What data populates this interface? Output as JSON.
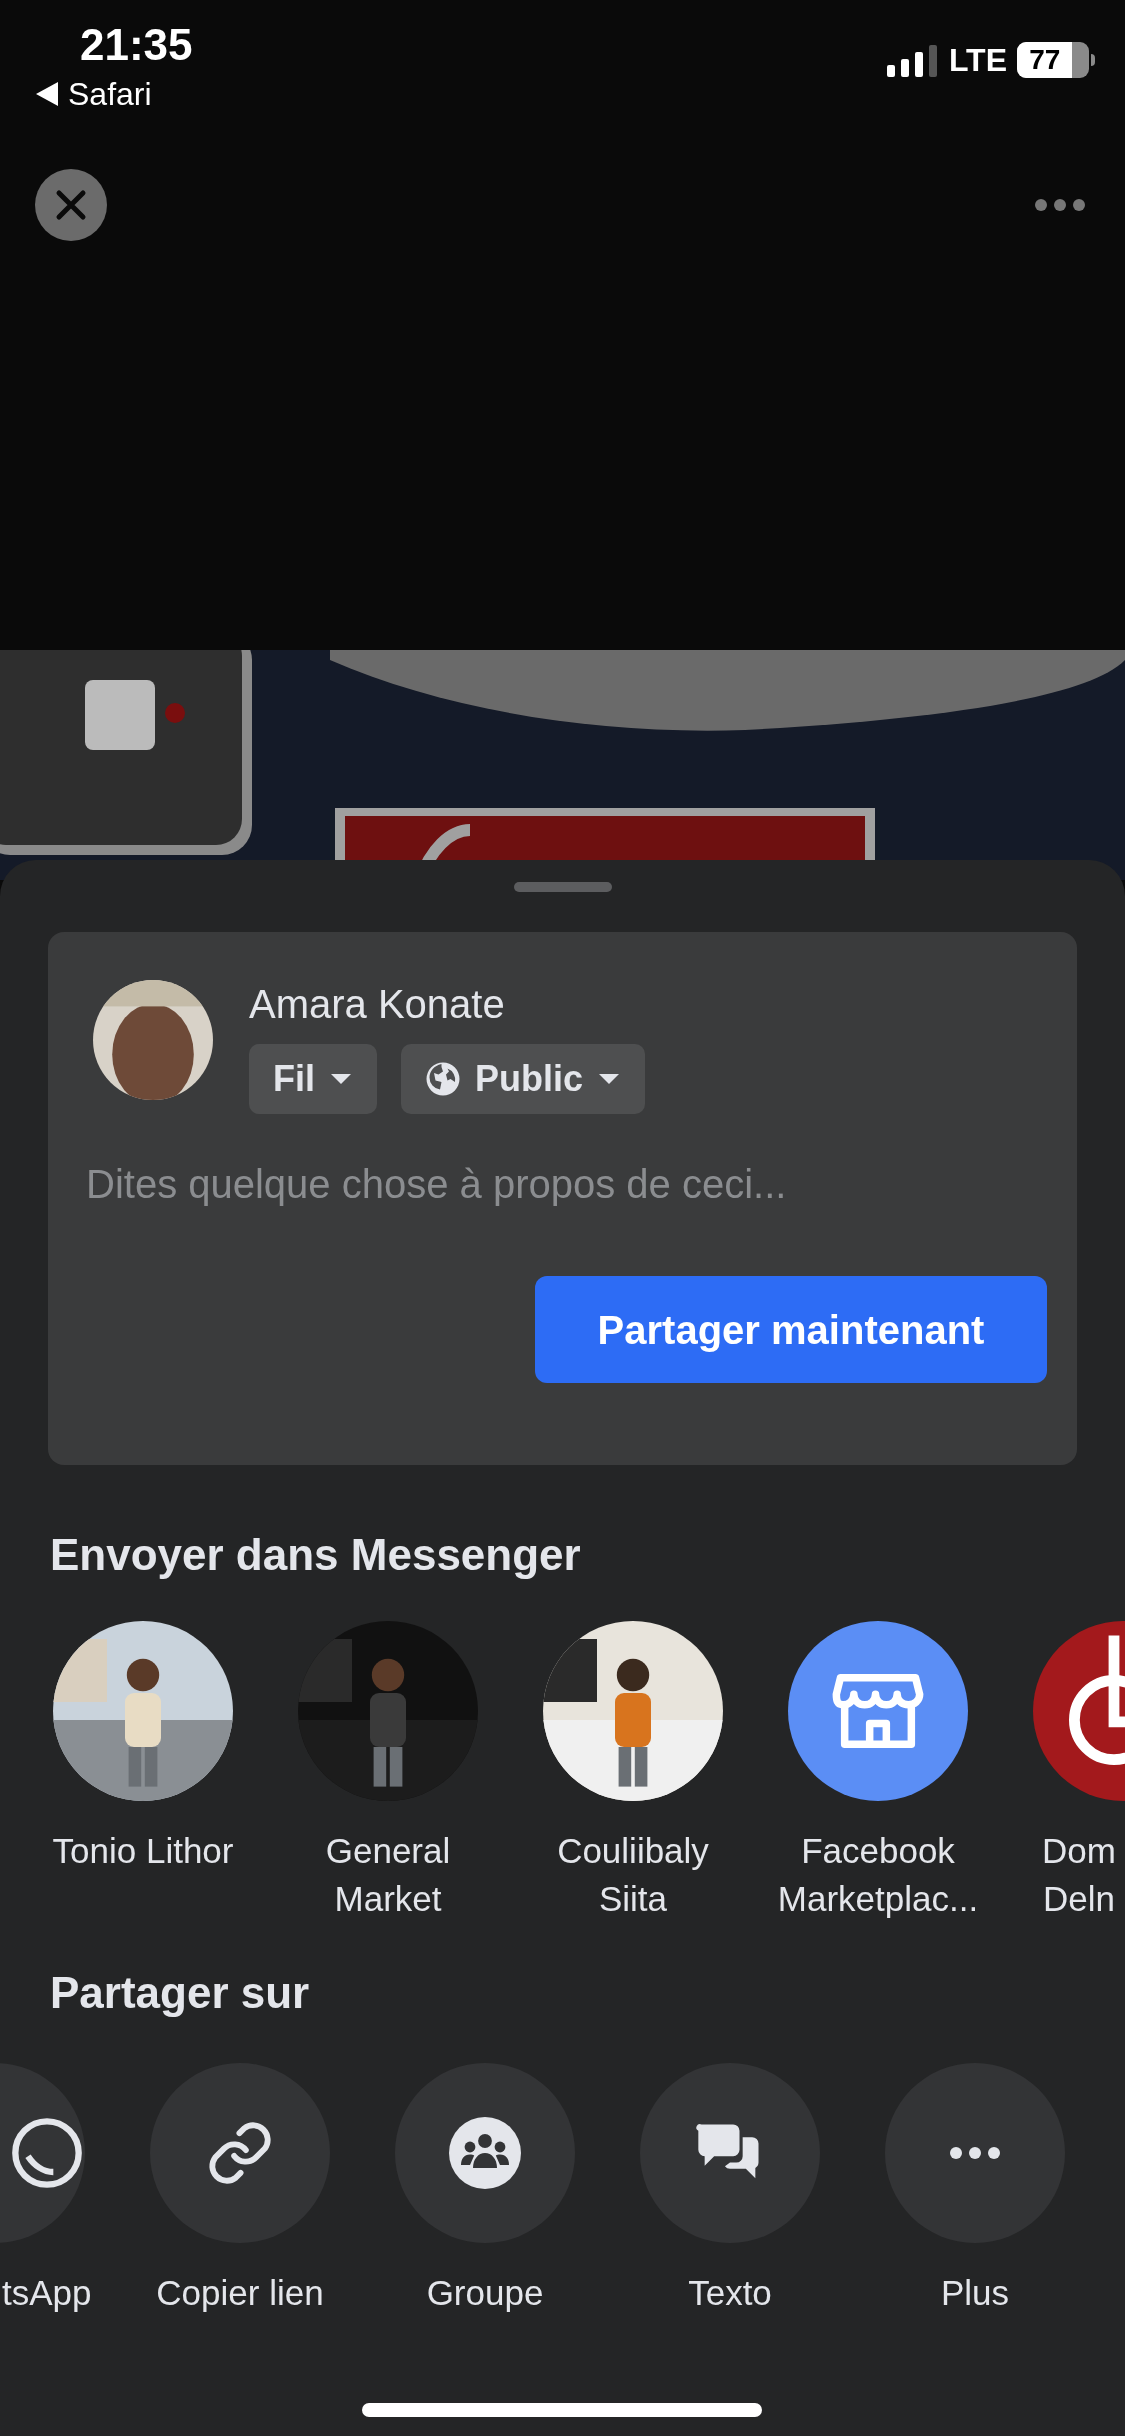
{
  "status_bar": {
    "time": "21:35",
    "back_app": "Safari",
    "network": "LTE",
    "battery": "77"
  },
  "composer": {
    "author": "Amara Konate",
    "audience": [
      {
        "label": "Fil",
        "kind": "feed"
      },
      {
        "label": "Public",
        "kind": "globe"
      }
    ],
    "placeholder": "Dites quelque chose à propos de ceci...",
    "button": "Partager maintenant"
  },
  "messenger": {
    "title": "Envoyer dans Messenger",
    "contacts": [
      {
        "name": "Tonio Lithor"
      },
      {
        "name": "General Market"
      },
      {
        "name": "Couliibaly Siita"
      },
      {
        "name": "Facebook Marketplac...",
        "kind": "store"
      },
      {
        "name": "Dom Deln",
        "kind": "logo"
      }
    ]
  },
  "share": {
    "title": "Partager sur",
    "targets": [
      {
        "label": "tsApp",
        "kind": "whatsapp"
      },
      {
        "label": "Copier lien",
        "kind": "link"
      },
      {
        "label": "Groupe",
        "kind": "group"
      },
      {
        "label": "Texto",
        "kind": "chat"
      },
      {
        "label": "Plus",
        "kind": "more"
      }
    ]
  }
}
